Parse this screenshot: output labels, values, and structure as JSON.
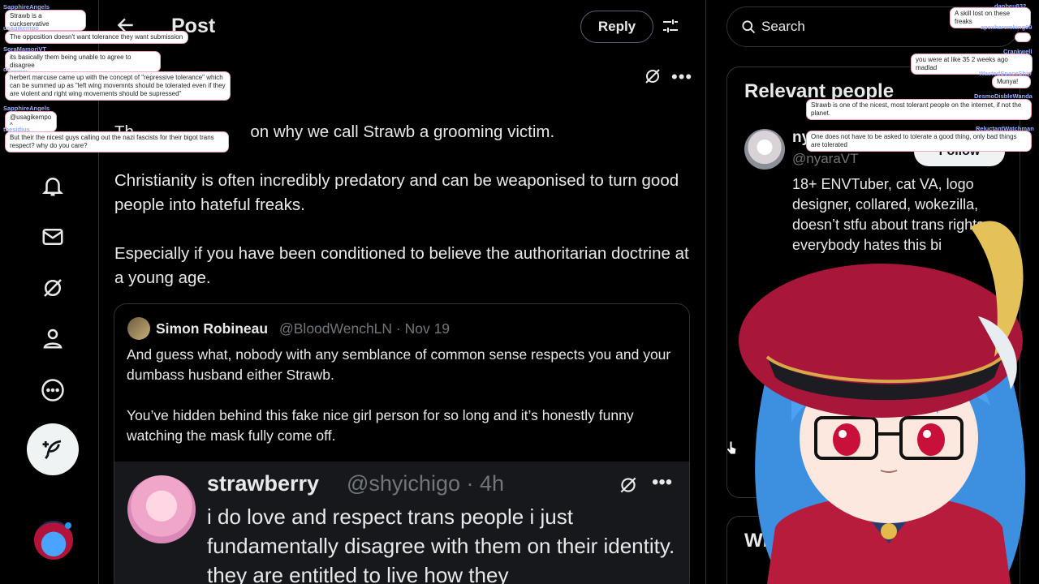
{
  "header": {
    "title": "Post",
    "reply_label": "Reply"
  },
  "post": {
    "paragraph1_visible": "on why we call Strawb a grooming victim.",
    "paragraph1_partial": "Th",
    "paragraph2": "Christianity is often incredibly predatory and can be weaponised to turn good people into hateful freaks.",
    "paragraph3": "Especially if you have been conditioned to believe the authoritarian doctrine at a young age."
  },
  "quote": {
    "name": "Simon Robineau",
    "handle": "@BloodWenchLN · Nov 19",
    "text1": "And guess what, nobody with any semblance of common sense respects you and your dumbass husband either Strawb.",
    "text2": "You’ve hidden behind this fake nice girl person for so long and it’s honestly funny watching the mask fully come off."
  },
  "reply": {
    "name": "strawberry",
    "handle": "@shyichigo · 4h",
    "text": "i do love and respect trans people i just fundamentally disagree with them on their identity. they are entitled to live how they"
  },
  "search": {
    "placeholder": "Search"
  },
  "relevant_people": {
    "title": "Relevant people",
    "name": "ny",
    "handle": "@nyaraVT",
    "follow_label": "Follow",
    "bio": "18+ ENVTuber, cat VA, logo designer, collared, wokezilla, doesn’t stfu about trans rights, everybody hates this bi"
  },
  "whats_happening": {
    "title": "Wh"
  },
  "chat_left": [
    {
      "user": "SapphireAngels",
      "msg": "Strawb is a cuckservative"
    },
    {
      "user": "usagikempo",
      "msg": "The opposition doesn't want tolerance they want submission"
    },
    {
      "user": "SoraMamoriVT",
      "msg": "its basically them being unable to agree to disagree"
    },
    {
      "user": "de..........",
      "msg": "herbert marcuse came up with the concept of \"repressive tolerance\" which can be summed up as \"left wing movemnts should be tolerated even if they are violent and right wing movements should be supressed\""
    },
    {
      "user": "SapphireAngels",
      "msg": "@usagikempo ^"
    },
    {
      "user": "thesidius",
      "msg": "But their the nicest guys calling out the nazi fascists for their bigot trans respect? why do you care?"
    }
  ],
  "chat_right": [
    {
      "user": "danbeu832",
      "msg": "A skill lost on these freaks"
    },
    {
      "user": "apexharemking69",
      "msg": ""
    },
    {
      "user": "Crankwell",
      "msg": "you were at like 35 2 weeks ago madlad"
    },
    {
      "user": "WastedSpaceShip",
      "msg": "Munya!"
    },
    {
      "user": "DesmoDisbleWanda",
      "msg": "Strawb is one of the nicest, most tolerant people on the internet, if not the planet."
    },
    {
      "user": "ReluctantWatchman",
      "msg": "One does not have to be asked to tolerate a good thing, only bad things are tolerated"
    }
  ],
  "colors": {
    "background": "#000000",
    "text": "#e7e9ea",
    "muted": "#71767b",
    "border": "#2f3336",
    "accent": "#1d9bf0"
  }
}
